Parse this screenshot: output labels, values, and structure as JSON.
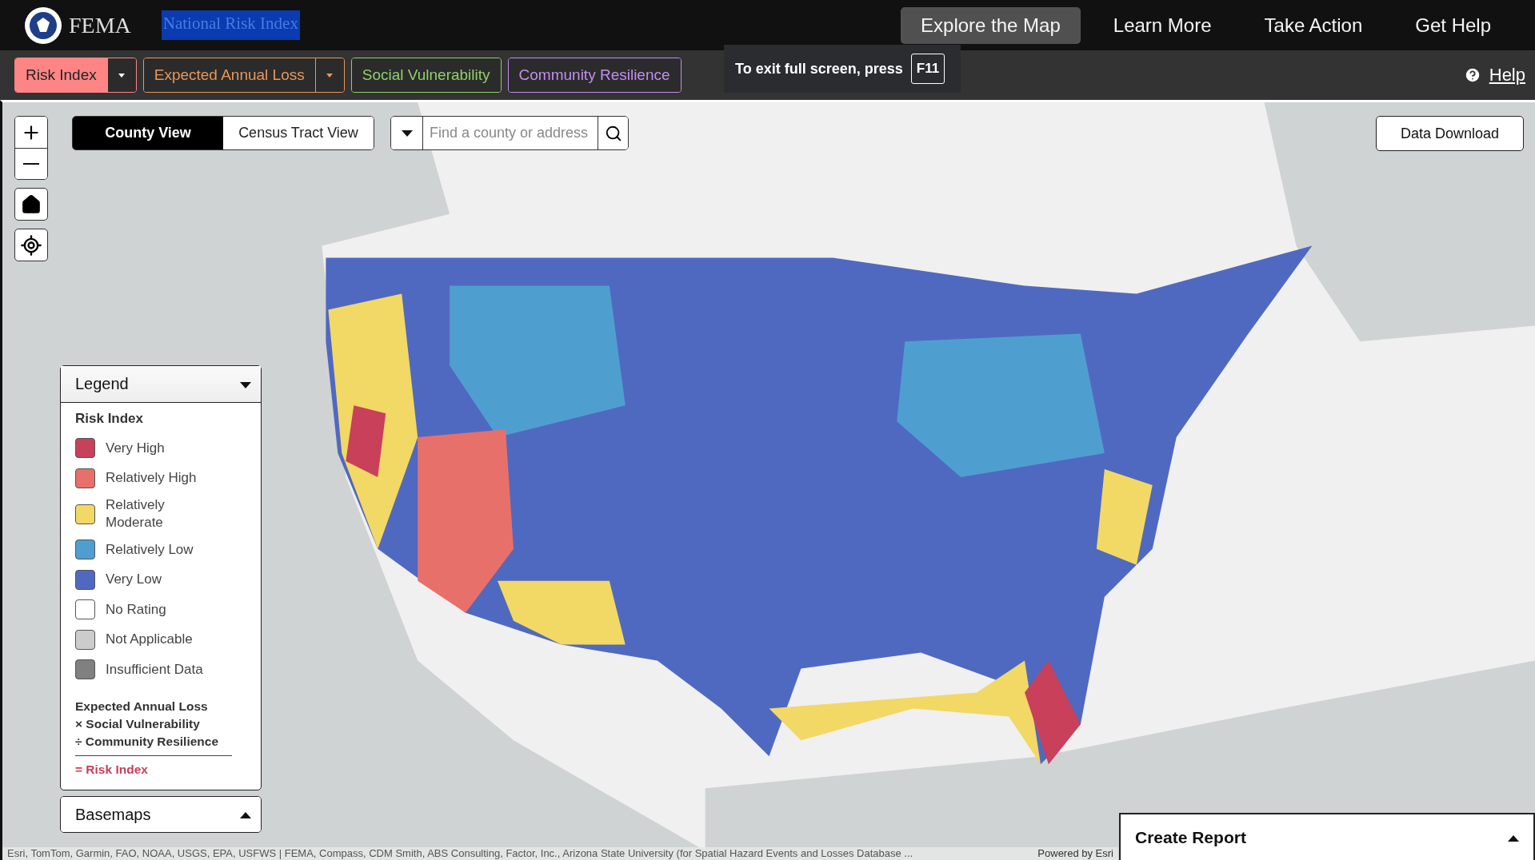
{
  "header": {
    "logo_text": "FEMA",
    "site_title": "National Risk Index",
    "nav": [
      {
        "label": "Explore the Map",
        "selected": true
      },
      {
        "label": "Learn More",
        "selected": false
      },
      {
        "label": "Take Action",
        "selected": false
      },
      {
        "label": "Get Help",
        "selected": false
      }
    ]
  },
  "layer_tabs": [
    {
      "label": "Risk Index",
      "color": "#ff8585",
      "selected": true,
      "has_dropdown": true
    },
    {
      "label": "Expected Annual Loss",
      "color": "#e8975a",
      "selected": false,
      "has_dropdown": true
    },
    {
      "label": "Social Vulnerability",
      "color": "#8fd16a",
      "selected": false,
      "has_dropdown": false
    },
    {
      "label": "Community Resilience",
      "color": "#c38ef0",
      "selected": false,
      "has_dropdown": false
    }
  ],
  "toast": {
    "text": "To exit full screen, press",
    "key": "F11"
  },
  "help": "Help",
  "view_toggle": [
    {
      "label": "County View",
      "selected": true
    },
    {
      "label": "Census Tract View",
      "selected": false
    }
  ],
  "search": {
    "placeholder": "Find a county or address"
  },
  "data_download": "Data Download",
  "legend": {
    "title": "Legend",
    "expanded": true,
    "heading": "Risk Index",
    "items": [
      {
        "label": "Very High",
        "color": "#c8405a"
      },
      {
        "label": "Relatively High",
        "color": "#e8706a"
      },
      {
        "label": "Relatively Moderate",
        "color": "#f2d865"
      },
      {
        "label": "Relatively Low",
        "color": "#4e9fd0"
      },
      {
        "label": "Very Low",
        "color": "#5069c0"
      },
      {
        "label": "No Rating",
        "color": "#ffffff"
      },
      {
        "label": "Not Applicable",
        "color": "#cccccc"
      },
      {
        "label": "Insufficient Data",
        "color": "#808080"
      }
    ],
    "formula": [
      "Expected Annual Loss",
      "× Social Vulnerability",
      "÷ Community Resilience"
    ],
    "result": "= Risk Index"
  },
  "basemaps": {
    "title": "Basemaps",
    "expanded": false
  },
  "create_report": {
    "title": "Create Report",
    "expanded": false
  },
  "attribution": "Esri, TomTom, Garmin, FAO, NOAA, USGS, EPA, USFWS | FEMA, Compass, CDM Smith, ABS Consulting, Factor, Inc., Arizona State University (for Spatial Hazard Events and Losses Database ...",
  "powered_by": "Powered by Esri"
}
